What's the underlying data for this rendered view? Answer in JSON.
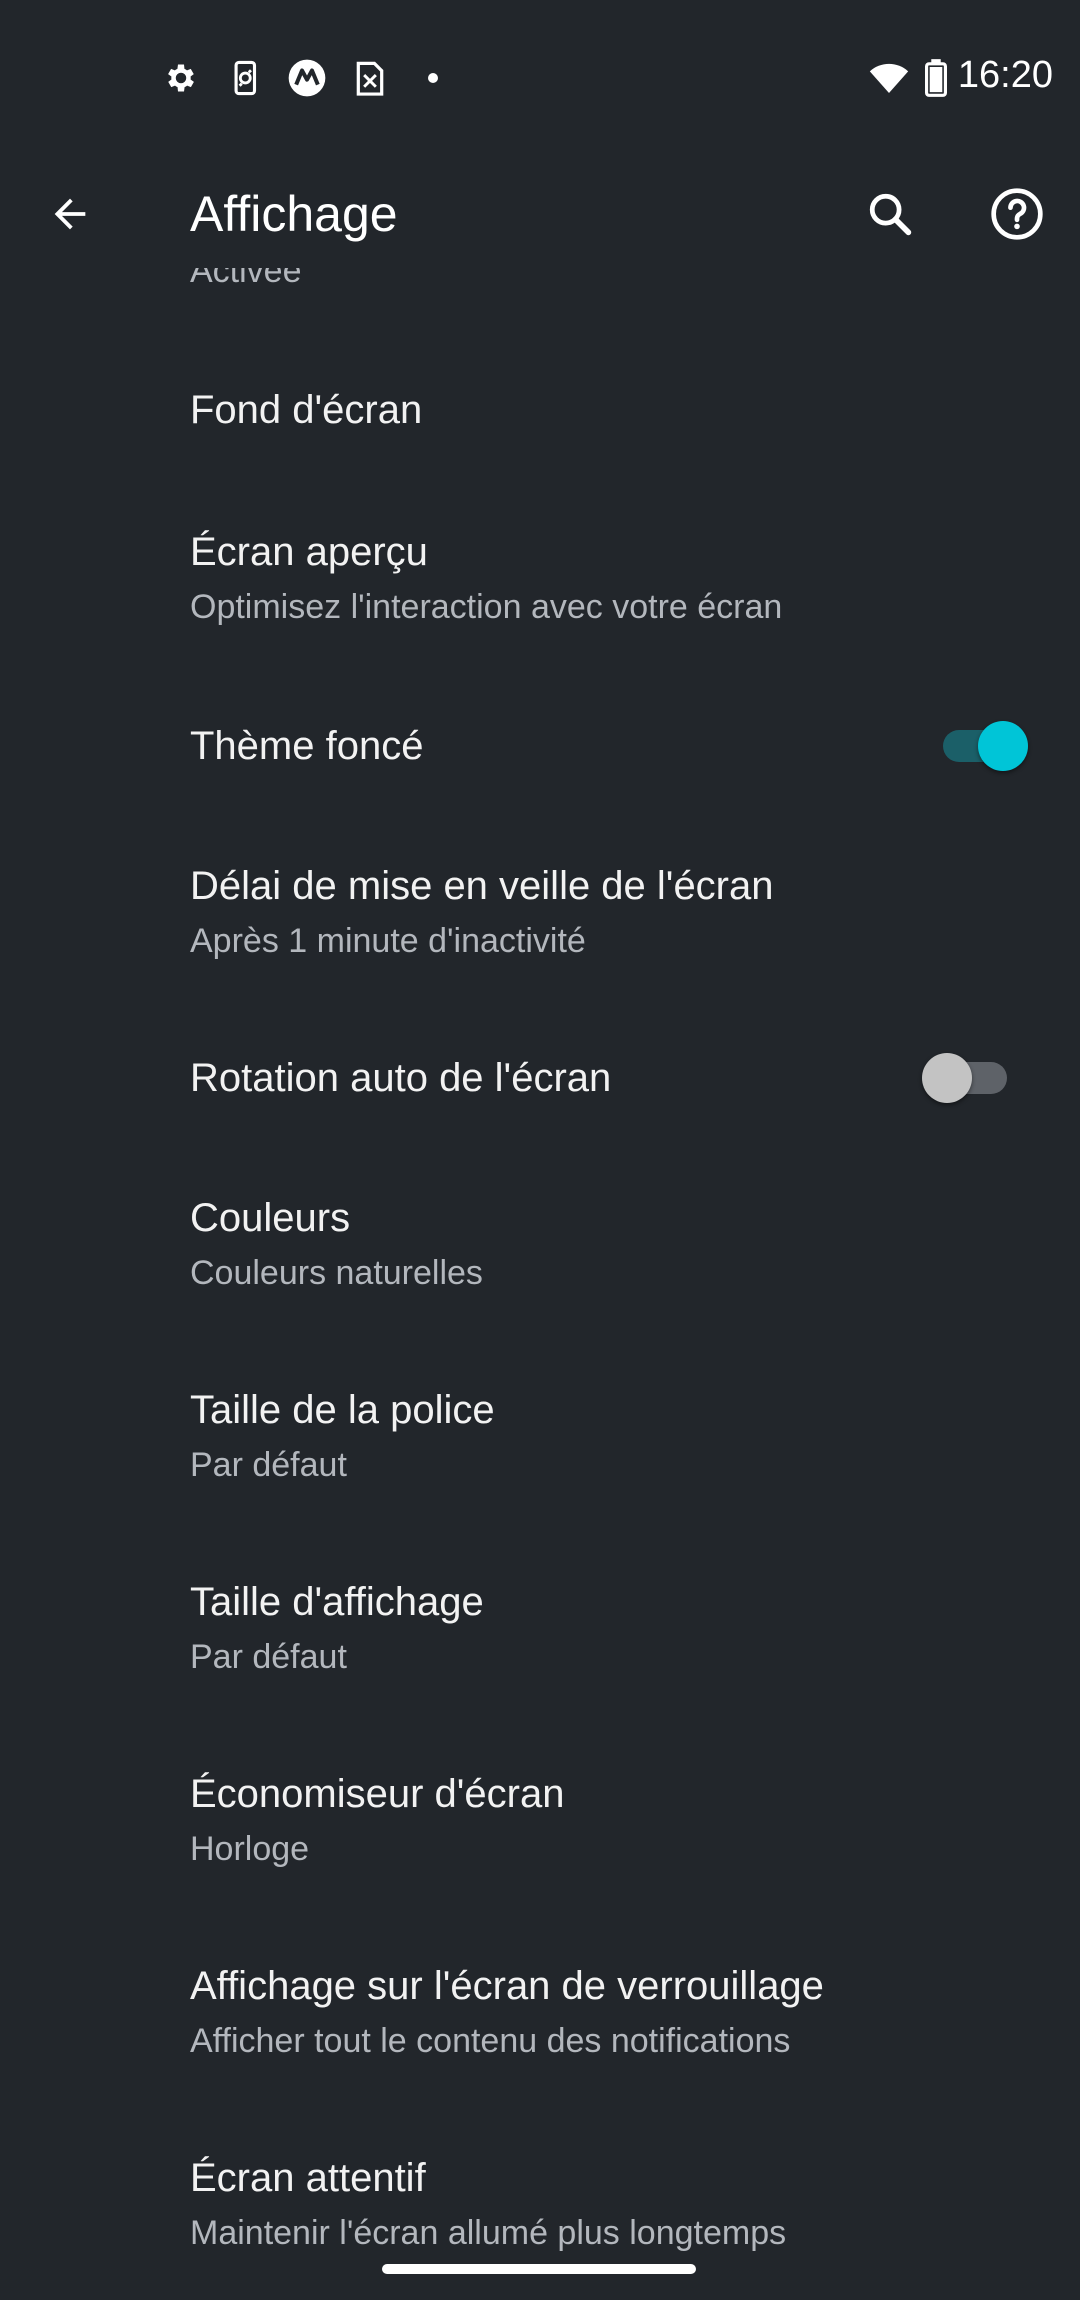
{
  "status_bar": {
    "time": "16:20",
    "left_icons": [
      "gear-icon",
      "phone-sync-icon",
      "motorola-icon",
      "sim-x-icon",
      "dot-icon"
    ],
    "right_icons": [
      "wifi-icon",
      "battery-icon"
    ]
  },
  "app_bar": {
    "title": "Affichage",
    "back_icon": "arrow-back-icon",
    "search_icon": "search-icon",
    "help_icon": "help-circle-icon"
  },
  "partial_item": {
    "subtitle": "Activée"
  },
  "settings": [
    {
      "title": "Fond d'écran",
      "subtitle": ""
    },
    {
      "title": "Écran aperçu",
      "subtitle": "Optimisez l'interaction avec votre écran"
    },
    {
      "title": "Thème foncé",
      "subtitle": "",
      "switch": true
    },
    {
      "title": "Délai de mise en veille de l'écran",
      "subtitle": "Après 1 minute d'inactivité"
    },
    {
      "title": "Rotation auto de l'écran",
      "subtitle": "",
      "switch": false
    },
    {
      "title": "Couleurs",
      "subtitle": "Couleurs naturelles"
    },
    {
      "title": "Taille de la police",
      "subtitle": "Par défaut"
    },
    {
      "title": "Taille d'affichage",
      "subtitle": "Par défaut"
    },
    {
      "title": "Économiseur d'écran",
      "subtitle": "Horloge"
    },
    {
      "title": "Affichage sur l'écran de verrouillage",
      "subtitle": "Afficher tout le contenu des notifications"
    },
    {
      "title": "Écran attentif",
      "subtitle": "Maintenir l'écran allumé plus longtemps"
    }
  ],
  "colors": {
    "background": "#22262b",
    "accent": "#00c5d7",
    "text_primary": "#f2f2f2",
    "text_secondary": "#b3b7bd"
  }
}
